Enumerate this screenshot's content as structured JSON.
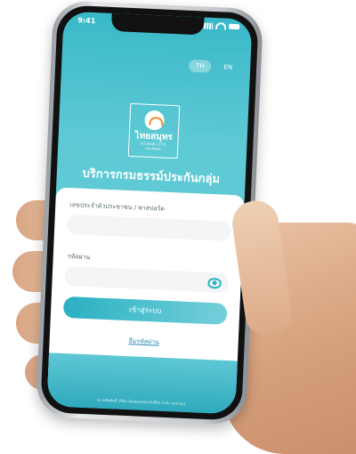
{
  "status_bar": {
    "time": "9:41"
  },
  "language": {
    "th": "TH",
    "en": "EN"
  },
  "logo": {
    "line1": "ไทยสมุทร",
    "line2": "OCEAN LIFE",
    "line3": "INSURANCE"
  },
  "screen": {
    "title": "บริการกรมธรรม์ประกันกลุ่ม"
  },
  "form": {
    "id_label": "เลขประจำตัวประชาชน / พาสปอร์ต",
    "password_label": "รหัสผ่าน",
    "login_button": "เข้าสู่ระบบ",
    "forgot_link": "ลืมรหัสผ่าน"
  },
  "footer": {
    "text": "สงวนลิขสิทธิ์ บริษัท ไทยสมุทรประกันชีวิต จำกัด (มหาชน)"
  },
  "colors": {
    "accent": "#3bb6c6",
    "button_start": "#2bb0c2",
    "button_end": "#74d0da"
  }
}
